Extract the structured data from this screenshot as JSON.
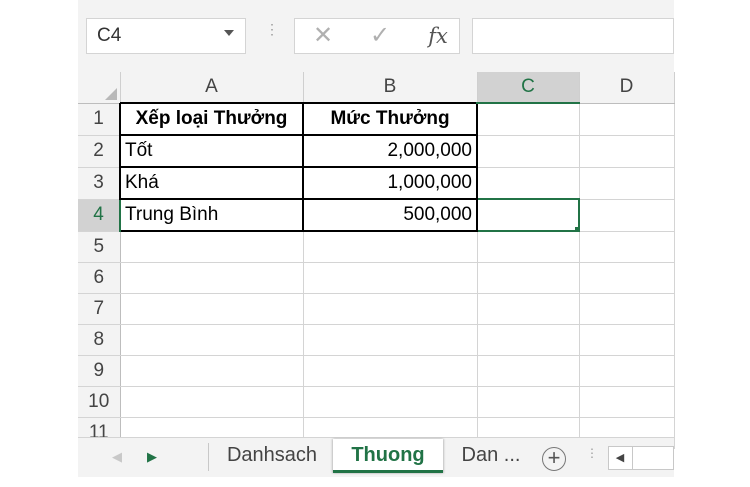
{
  "name_box": {
    "value": "C4",
    "dropdown_icon": "chevron-down-icon"
  },
  "formula_bar": {
    "cancel_glyph": "✕",
    "enter_glyph": "✓",
    "fx_label": "fx",
    "formula_value": ""
  },
  "columns": [
    "A",
    "B",
    "C",
    "D"
  ],
  "rows": [
    "1",
    "2",
    "3",
    "4",
    "5",
    "6",
    "7",
    "8",
    "9",
    "10",
    "11"
  ],
  "active_cell": "C4",
  "cells": {
    "A1": "Xếp loại Thưởng",
    "B1": "Mức Thưởng",
    "A2": "Tốt",
    "B2": "2,000,000",
    "A3": "Khá",
    "B3": "1,000,000",
    "A4": "Trung Bình",
    "B4": "500,000"
  },
  "sheet_tabs": {
    "prev_glyph": "◀",
    "next_glyph": "▶",
    "tabs": [
      "Danhsach",
      "Thuong",
      "Dan ..."
    ],
    "active_tab": "Thuong",
    "add_label": "+"
  },
  "colors": {
    "accent": "#217346",
    "grid_line": "#d4d4d4",
    "header_bg": "#f3f3f3"
  }
}
